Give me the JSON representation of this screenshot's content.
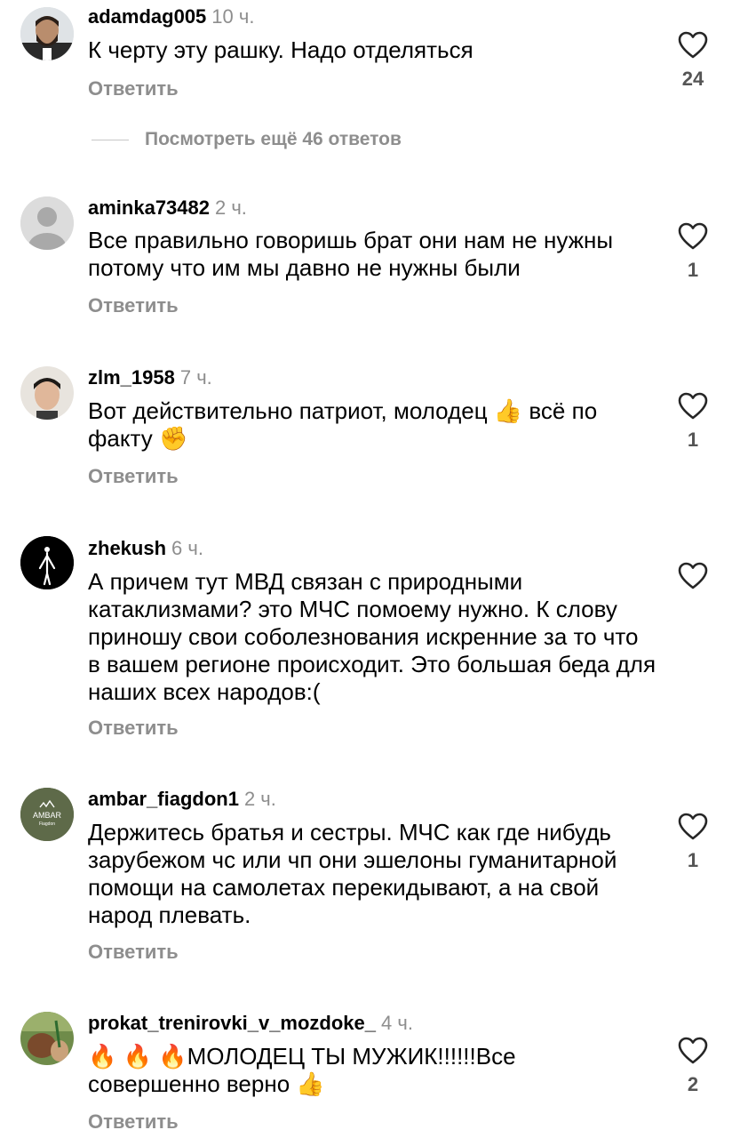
{
  "comments": [
    {
      "username": "adamdag005",
      "time": "10 ч.",
      "text": "К черту эту рашку. Надо отделяться",
      "reply": "Ответить",
      "likes": "24"
    },
    {
      "username": "aminka73482",
      "time": "2 ч.",
      "text": "Все правильно говоришь брат они нам не нужны потому что им мы давно не нужны были",
      "reply": "Ответить",
      "likes": "1"
    },
    {
      "username": "zlm_1958",
      "time": "7 ч.",
      "text": "Вот действительно патриот, молодец 👍 всё по факту ✊",
      "reply": "Ответить",
      "likes": "1"
    },
    {
      "username": "zhekush",
      "time": "6 ч.",
      "text": "А причем тут МВД связан с природными катаклизмами? это МЧС помоему нужно. К слову приношу свои соболезнования искренние за то что в вашем регионе происходит. Это большая беда для наших всех народов:(",
      "reply": "Ответить",
      "likes": ""
    },
    {
      "username": "ambar_fiagdon1",
      "time": "2 ч.",
      "text": "Держитесь братья и сестры. МЧС как где нибудь зарубежом чс или чп они эшелоны гуманитарной помощи на самолетах перекидывают, а на свой народ плевать.",
      "reply": "Ответить",
      "likes": "1",
      "avatar_text": "AMBAR",
      "avatar_subtext": "Fiagdon"
    },
    {
      "username": "prokat_trenirovki_v_mozdoke_",
      "time": "4 ч.",
      "text": "🔥 🔥 🔥МОЛОДЕЦ ТЫ МУЖИК!!!!!!Все совершенно верно 👍",
      "reply": "Ответить",
      "likes": "2"
    }
  ],
  "view_more": "Посмотреть ещё 46 ответов",
  "icons": {
    "like": "heart-outline-icon"
  },
  "colors": {
    "secondary_text": "#8e8e8e",
    "avatar_ambar_bg": "#5e6a49"
  }
}
